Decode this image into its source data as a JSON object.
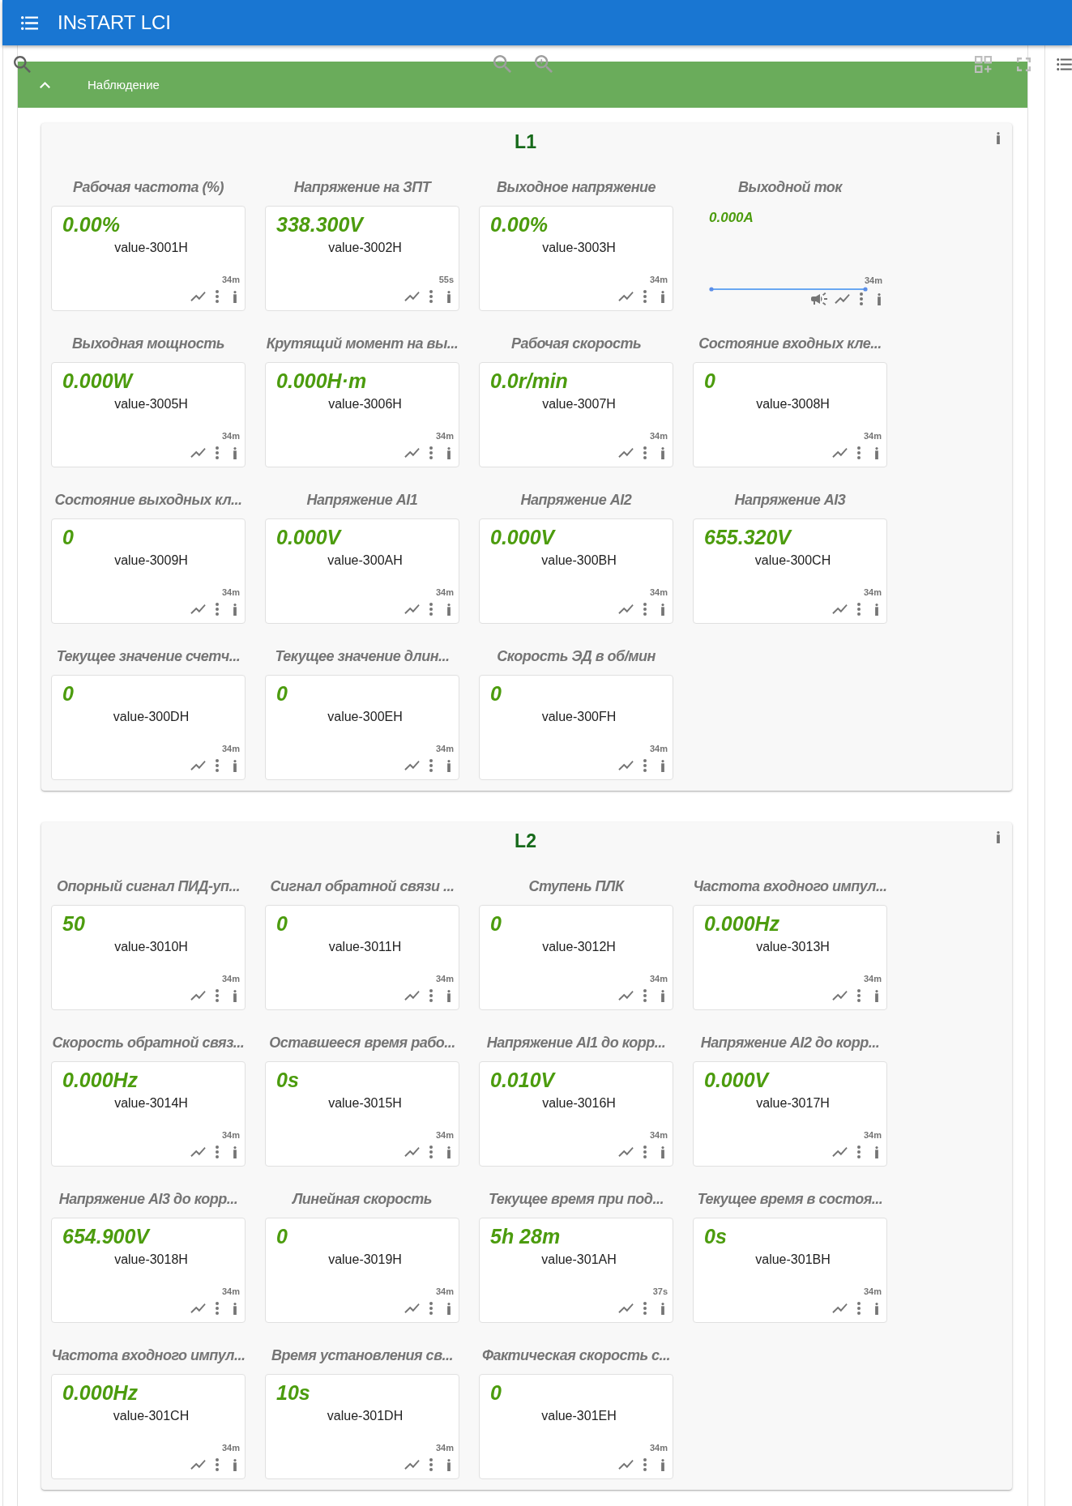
{
  "app_bar": {
    "title": "INsTART LCI"
  },
  "section": {
    "title": "Наблюдение",
    "expanded": true
  },
  "groups": [
    {
      "title": "L1",
      "widgets": [
        {
          "kind": "tile",
          "label": "Рабочая частота (%)",
          "value": "0.00%",
          "tag": "value-3001H",
          "updated": "34m"
        },
        {
          "kind": "tile",
          "label": "Напряжение на ЗПТ",
          "value": "338.300V",
          "tag": "value-3002H",
          "updated": "55s"
        },
        {
          "kind": "tile",
          "label": "Выходное напряжение",
          "value": "0.00%",
          "tag": "value-3003H",
          "updated": "34m"
        },
        {
          "kind": "chart",
          "label": "Выходной ток",
          "value": "0.000A",
          "updated": "34m"
        },
        {
          "kind": "tile",
          "label": "Выходная мощность",
          "value": "0.000W",
          "tag": "value-3005H",
          "updated": "34m"
        },
        {
          "kind": "tile",
          "label": "Крутящий момент на вы...",
          "value": "0.000H·m",
          "tag": "value-3006H",
          "updated": "34m"
        },
        {
          "kind": "tile",
          "label": "Рабочая скорость",
          "value": "0.0r/min",
          "tag": "value-3007H",
          "updated": "34m"
        },
        {
          "kind": "tile",
          "label": "Состояние входных кле...",
          "value": "0",
          "tag": "value-3008H",
          "updated": "34m"
        },
        {
          "kind": "tile",
          "label": "Состояние выходных кл...",
          "value": "0",
          "tag": "value-3009H",
          "updated": "34m"
        },
        {
          "kind": "tile",
          "label": "Напряжение AI1",
          "value": "0.000V",
          "tag": "value-300AH",
          "updated": "34m"
        },
        {
          "kind": "tile",
          "label": "Напряжение AI2",
          "value": "0.000V",
          "tag": "value-300BH",
          "updated": "34m"
        },
        {
          "kind": "tile",
          "label": "Напряжение AI3",
          "value": "655.320V",
          "tag": "value-300CH",
          "updated": "34m"
        },
        {
          "kind": "tile",
          "label": "Текущее значение счетч...",
          "value": "0",
          "tag": "value-300DH",
          "updated": "34m"
        },
        {
          "kind": "tile",
          "label": "Текущее значение длин...",
          "value": "0",
          "tag": "value-300EH",
          "updated": "34m"
        },
        {
          "kind": "tile",
          "label": "Скорость ЭД в об/мин",
          "value": "0",
          "tag": "value-300FH",
          "updated": "34m"
        }
      ]
    },
    {
      "title": "L2",
      "widgets": [
        {
          "kind": "tile",
          "label": "Опорный сигнал ПИД-уп...",
          "value": "50",
          "tag": "value-3010H",
          "updated": "34m"
        },
        {
          "kind": "tile",
          "label": "Сигнал обратной связи ...",
          "value": "0",
          "tag": "value-3011H",
          "updated": "34m"
        },
        {
          "kind": "tile",
          "label": "Ступень ПЛК",
          "value": "0",
          "tag": "value-3012H",
          "updated": "34m"
        },
        {
          "kind": "tile",
          "label": "Частота входного импул...",
          "value": "0.000Hz",
          "tag": "value-3013H",
          "updated": "34m"
        },
        {
          "kind": "tile",
          "label": "Скорость обратной связ...",
          "value": "0.000Hz",
          "tag": "value-3014H",
          "updated": "34m"
        },
        {
          "kind": "tile",
          "label": "Оставшееся время рабо...",
          "value": "0s",
          "tag": "value-3015H",
          "updated": "34m"
        },
        {
          "kind": "tile",
          "label": "Напряжение AI1 до корр...",
          "value": "0.010V",
          "tag": "value-3016H",
          "updated": "34m"
        },
        {
          "kind": "tile",
          "label": "Напряжение AI2 до корр...",
          "value": "0.000V",
          "tag": "value-3017H",
          "updated": "34m"
        },
        {
          "kind": "tile",
          "label": "Напряжение AI3 до корр...",
          "value": "654.900V",
          "tag": "value-3018H",
          "updated": "34m"
        },
        {
          "kind": "tile",
          "label": "Линейная скорость",
          "value": "0",
          "tag": "value-3019H",
          "updated": "34m"
        },
        {
          "kind": "tile",
          "label": "Текущее время при под...",
          "value": "5h 28m",
          "tag": "value-301AH",
          "updated": "37s"
        },
        {
          "kind": "tile",
          "label": "Текущее время в состоя...",
          "value": "0s",
          "tag": "value-301BH",
          "updated": "34m"
        },
        {
          "kind": "tile",
          "label": "Частота входного импул...",
          "value": "0.000Hz",
          "tag": "value-301CH",
          "updated": "34m"
        },
        {
          "kind": "tile",
          "label": "Время установления св...",
          "value": "10s",
          "tag": "value-301DH",
          "updated": "34m"
        },
        {
          "kind": "tile",
          "label": "Фактическая скорость с...",
          "value": "0",
          "tag": "value-301EH",
          "updated": "34m"
        }
      ]
    }
  ]
}
